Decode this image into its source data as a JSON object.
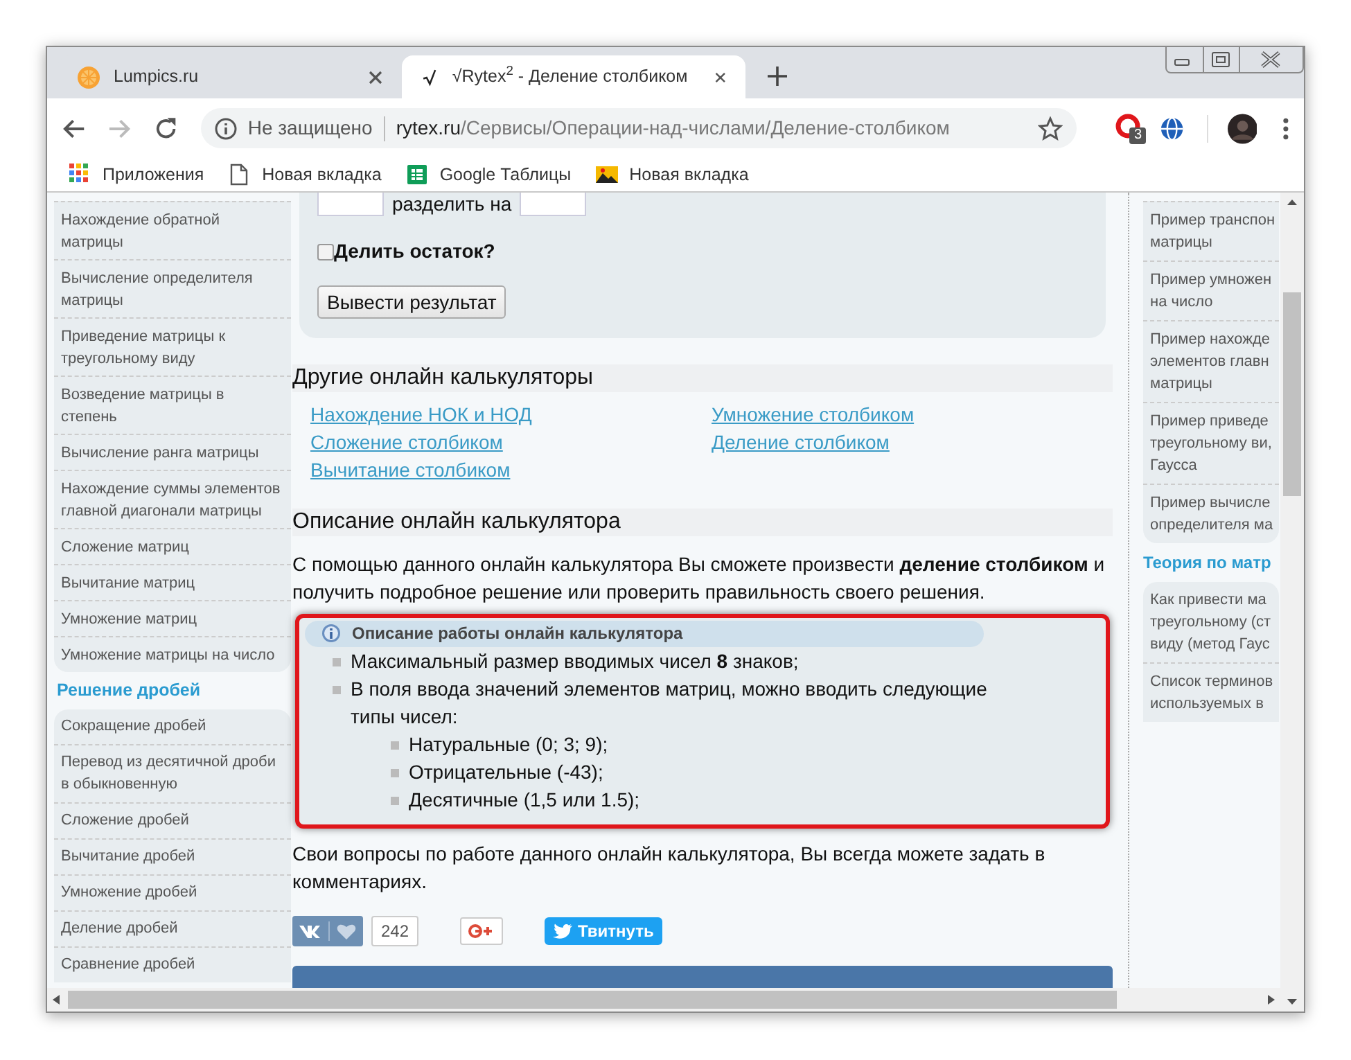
{
  "tabs": [
    {
      "title": "Lumpics.ru",
      "kind": "fruit",
      "selected": false
    },
    {
      "title": "√Rytex$^{2}$ - Деление столбиком",
      "kind": "root",
      "selected": true
    }
  ],
  "toolbar": {
    "security": "Не защищено",
    "url_host": "rytex.ru",
    "url_path": "/Сервисы/Операции-над-числами/Деление-столбиком",
    "extension_badge": "3"
  },
  "bookmarks": [
    {
      "label": "Приложения",
      "kind": "apps"
    },
    {
      "label": "Новая вкладка",
      "kind": "page"
    },
    {
      "label": "Google Таблицы",
      "kind": "sheets"
    },
    {
      "label": "Новая вкладка",
      "kind": "image"
    }
  ],
  "left_sidebar": [
    {
      "items": [
        "Нахождение обратной матрицы",
        "Вычисление определителя матрицы",
        "Приведение матрицы к треугольному виду",
        "Возведение матрицы в степень",
        "Вычисление ранга матрицы",
        "Нахождение суммы элементов главной диагонали матрицы",
        "Сложение матриц",
        "Вычитание матриц",
        "Умножение матриц",
        "Умножение матрицы на число"
      ]
    },
    {
      "heading": "Решение дробей",
      "items": [
        "Сокращение дробей",
        "Перевод из десятичной дроби в обыкновенную",
        "Сложение дробей",
        "Вычитание дробей",
        "Умножение дробей",
        "Деление дробей",
        "Сравнение дробей"
      ]
    }
  ],
  "form": {
    "divide_label": "разделить на",
    "remainder": {
      "label": "Делить остаток?",
      "checked": false
    },
    "submit": "Вывести результат"
  },
  "other_calculators": {
    "heading": "Другие онлайн калькуляторы",
    "links": [
      [
        "Нахождение НОК и НОД",
        "Сложение столбиком",
        "Вычитание столбиком"
      ],
      [
        "Умножение столбиком",
        "Деление столбиком"
      ]
    ]
  },
  "description": {
    "heading": "Описание онлайн калькулятора",
    "text": "С помощью данного онлайн калькулятора Вы сможете произвести **деление столбиком** и получить подробное решение или проверить правильность своего решения.",
    "info_box": {
      "title": "Описание работы онлайн калькулятора",
      "highlighted": true,
      "items": [
        {
          "text": "Максимальный размер вводимых чисел **8** знаков;"
        },
        {
          "text": "В поля ввода значений элементов матриц, можно вводить следующие типы чисел:",
          "children": [
            {
              "text": "Натуральные (0; 3; 9);"
            },
            {
              "text": "Отрицательные (-43);"
            },
            {
              "text": "Десятичные (1,5 или 1.5);"
            }
          ]
        }
      ]
    },
    "footer_text": "Свои вопросы по работе данного онлайн калькулятора, Вы всегда можете задать в комментариях."
  },
  "social": {
    "like_count": "242",
    "tweet": "Твитнуть"
  },
  "right_sidebar": [
    {
      "items": [
        [
          "Пример транспон",
          "матрицы"
        ],
        [
          "Пример умножен",
          "на число"
        ],
        [
          "Пример нахожде",
          "элементов главн",
          "матрицы"
        ],
        [
          "Пример приведе",
          "треугольному ви,",
          "Гаусса"
        ],
        [
          "Пример вычисле",
          "определителя ма"
        ]
      ]
    },
    {
      "heading": "Теория по матр",
      "items": [
        [
          "Как привести ма",
          "треугольному (ст",
          "виду (метод Гаус"
        ],
        [
          "Список терминов",
          "используемых в"
        ]
      ]
    }
  ]
}
